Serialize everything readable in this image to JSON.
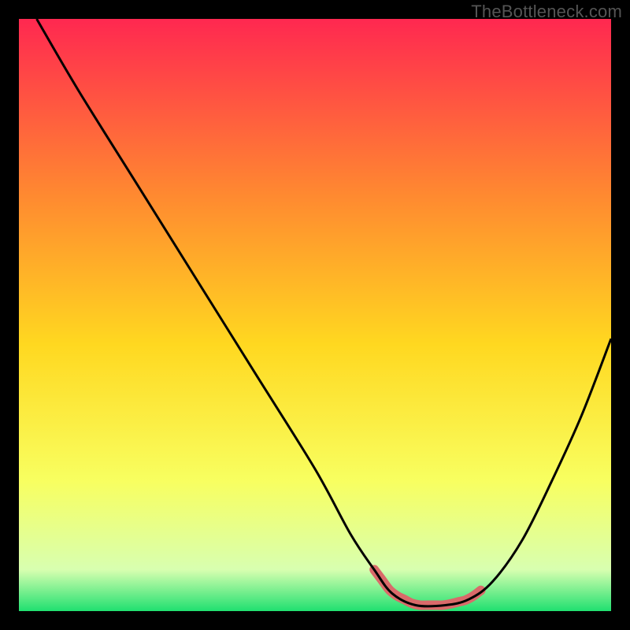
{
  "watermark": "TheBottleneck.com",
  "chart_data": {
    "type": "line",
    "title": "",
    "xlabel": "",
    "ylabel": "",
    "xlim": [
      0,
      100
    ],
    "ylim": [
      0,
      100
    ],
    "grid": false,
    "series": [
      {
        "name": "bottleneck-curve",
        "x": [
          3,
          10,
          20,
          30,
          40,
          50,
          56,
          60,
          63,
          67,
          72,
          76,
          80,
          85,
          90,
          95,
          100
        ],
        "y": [
          100,
          88,
          72,
          56,
          40,
          24,
          13,
          7,
          3,
          1,
          1,
          2,
          5,
          12,
          22,
          33,
          46
        ]
      }
    ],
    "valley_band": {
      "name": "valley-highlight",
      "x_start": 60,
      "x_end": 78,
      "color": "#d96a6a"
    },
    "background_gradient": {
      "top": "#ff2850",
      "upper_mid": "#ff8a30",
      "mid": "#ffd820",
      "lower_mid": "#f8ff60",
      "near_bottom": "#d8ffb0",
      "bottom": "#20e070"
    }
  }
}
